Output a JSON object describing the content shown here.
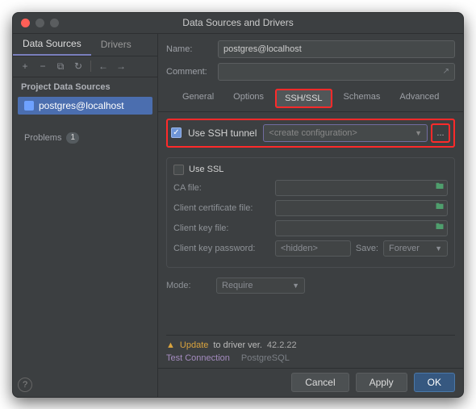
{
  "title": "Data Sources and Drivers",
  "sidebar": {
    "tabs": [
      "Data Sources",
      "Drivers"
    ],
    "section": "Project Data Sources",
    "item": {
      "name": "postgres@localhost"
    },
    "problems": {
      "label": "Problems",
      "count": "1"
    }
  },
  "form": {
    "name_label": "Name:",
    "name_value": "postgres@localhost",
    "comment_label": "Comment:"
  },
  "tabs": [
    "General",
    "Options",
    "SSH/SSL",
    "Schemas",
    "Advanced"
  ],
  "ssh": {
    "label": "Use SSH tunnel",
    "select_placeholder": "<create configuration>",
    "dots": "..."
  },
  "ssl": {
    "use_label": "Use SSL",
    "ca": "CA file:",
    "cert": "Client certificate file:",
    "key": "Client key file:",
    "pwd": "Client key password:",
    "pwd_value": "<hidden>",
    "save_label": "Save:",
    "save_value": "Forever"
  },
  "mode": {
    "label": "Mode:",
    "value": "Require"
  },
  "notice": {
    "update": "Update",
    "rest": "to driver ver.",
    "ver": "42.2.22"
  },
  "test": {
    "label": "Test Connection",
    "db": "PostgreSQL"
  },
  "footer": {
    "cancel": "Cancel",
    "apply": "Apply",
    "ok": "OK"
  }
}
